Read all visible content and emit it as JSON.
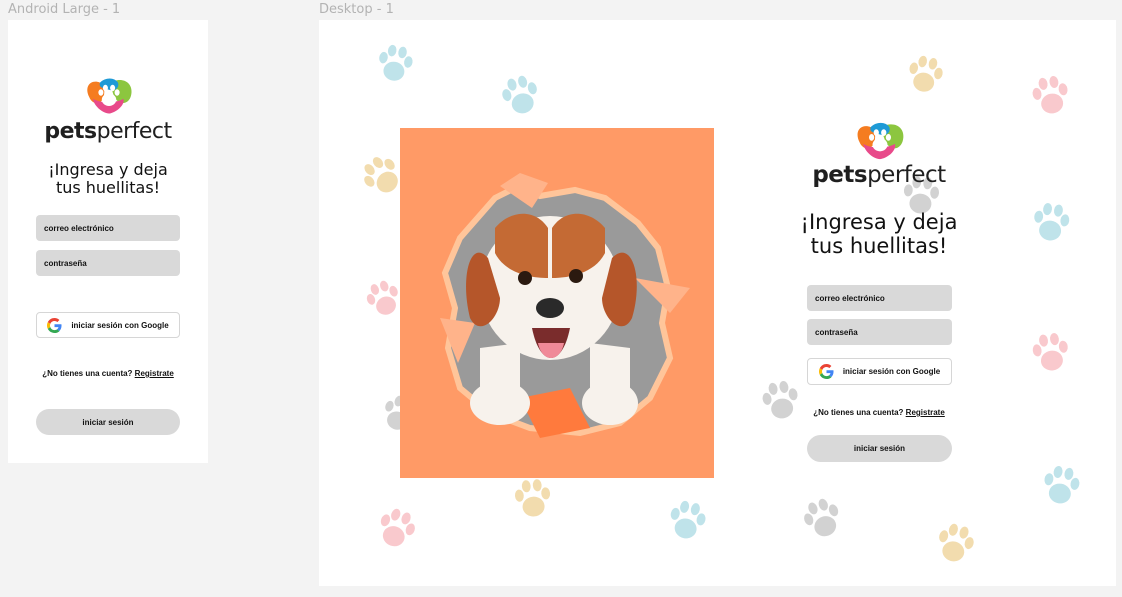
{
  "frames": {
    "android_label": "Android Large - 1",
    "desktop_label": "Desktop - 1"
  },
  "brand": {
    "name_bold": "pets",
    "name_regular": "perfect"
  },
  "headline": {
    "line1": "¡Ingresa y deja",
    "line2": "tus huellitas!"
  },
  "form": {
    "email_placeholder": "correo electrónico",
    "password_placeholder": "contraseña",
    "google_label": "iniciar sesión con Google",
    "no_account": "¿No tienes una cuenta? ",
    "register_link": "Registrate",
    "submit_label": "iniciar sesión"
  },
  "colors": {
    "paw_blue": "#bfe3ea",
    "paw_yellow": "#f2dcae",
    "paw_pink": "#f9c9cd",
    "paw_gray": "#d2d2d2",
    "hero_bg": "#ff9a66"
  }
}
